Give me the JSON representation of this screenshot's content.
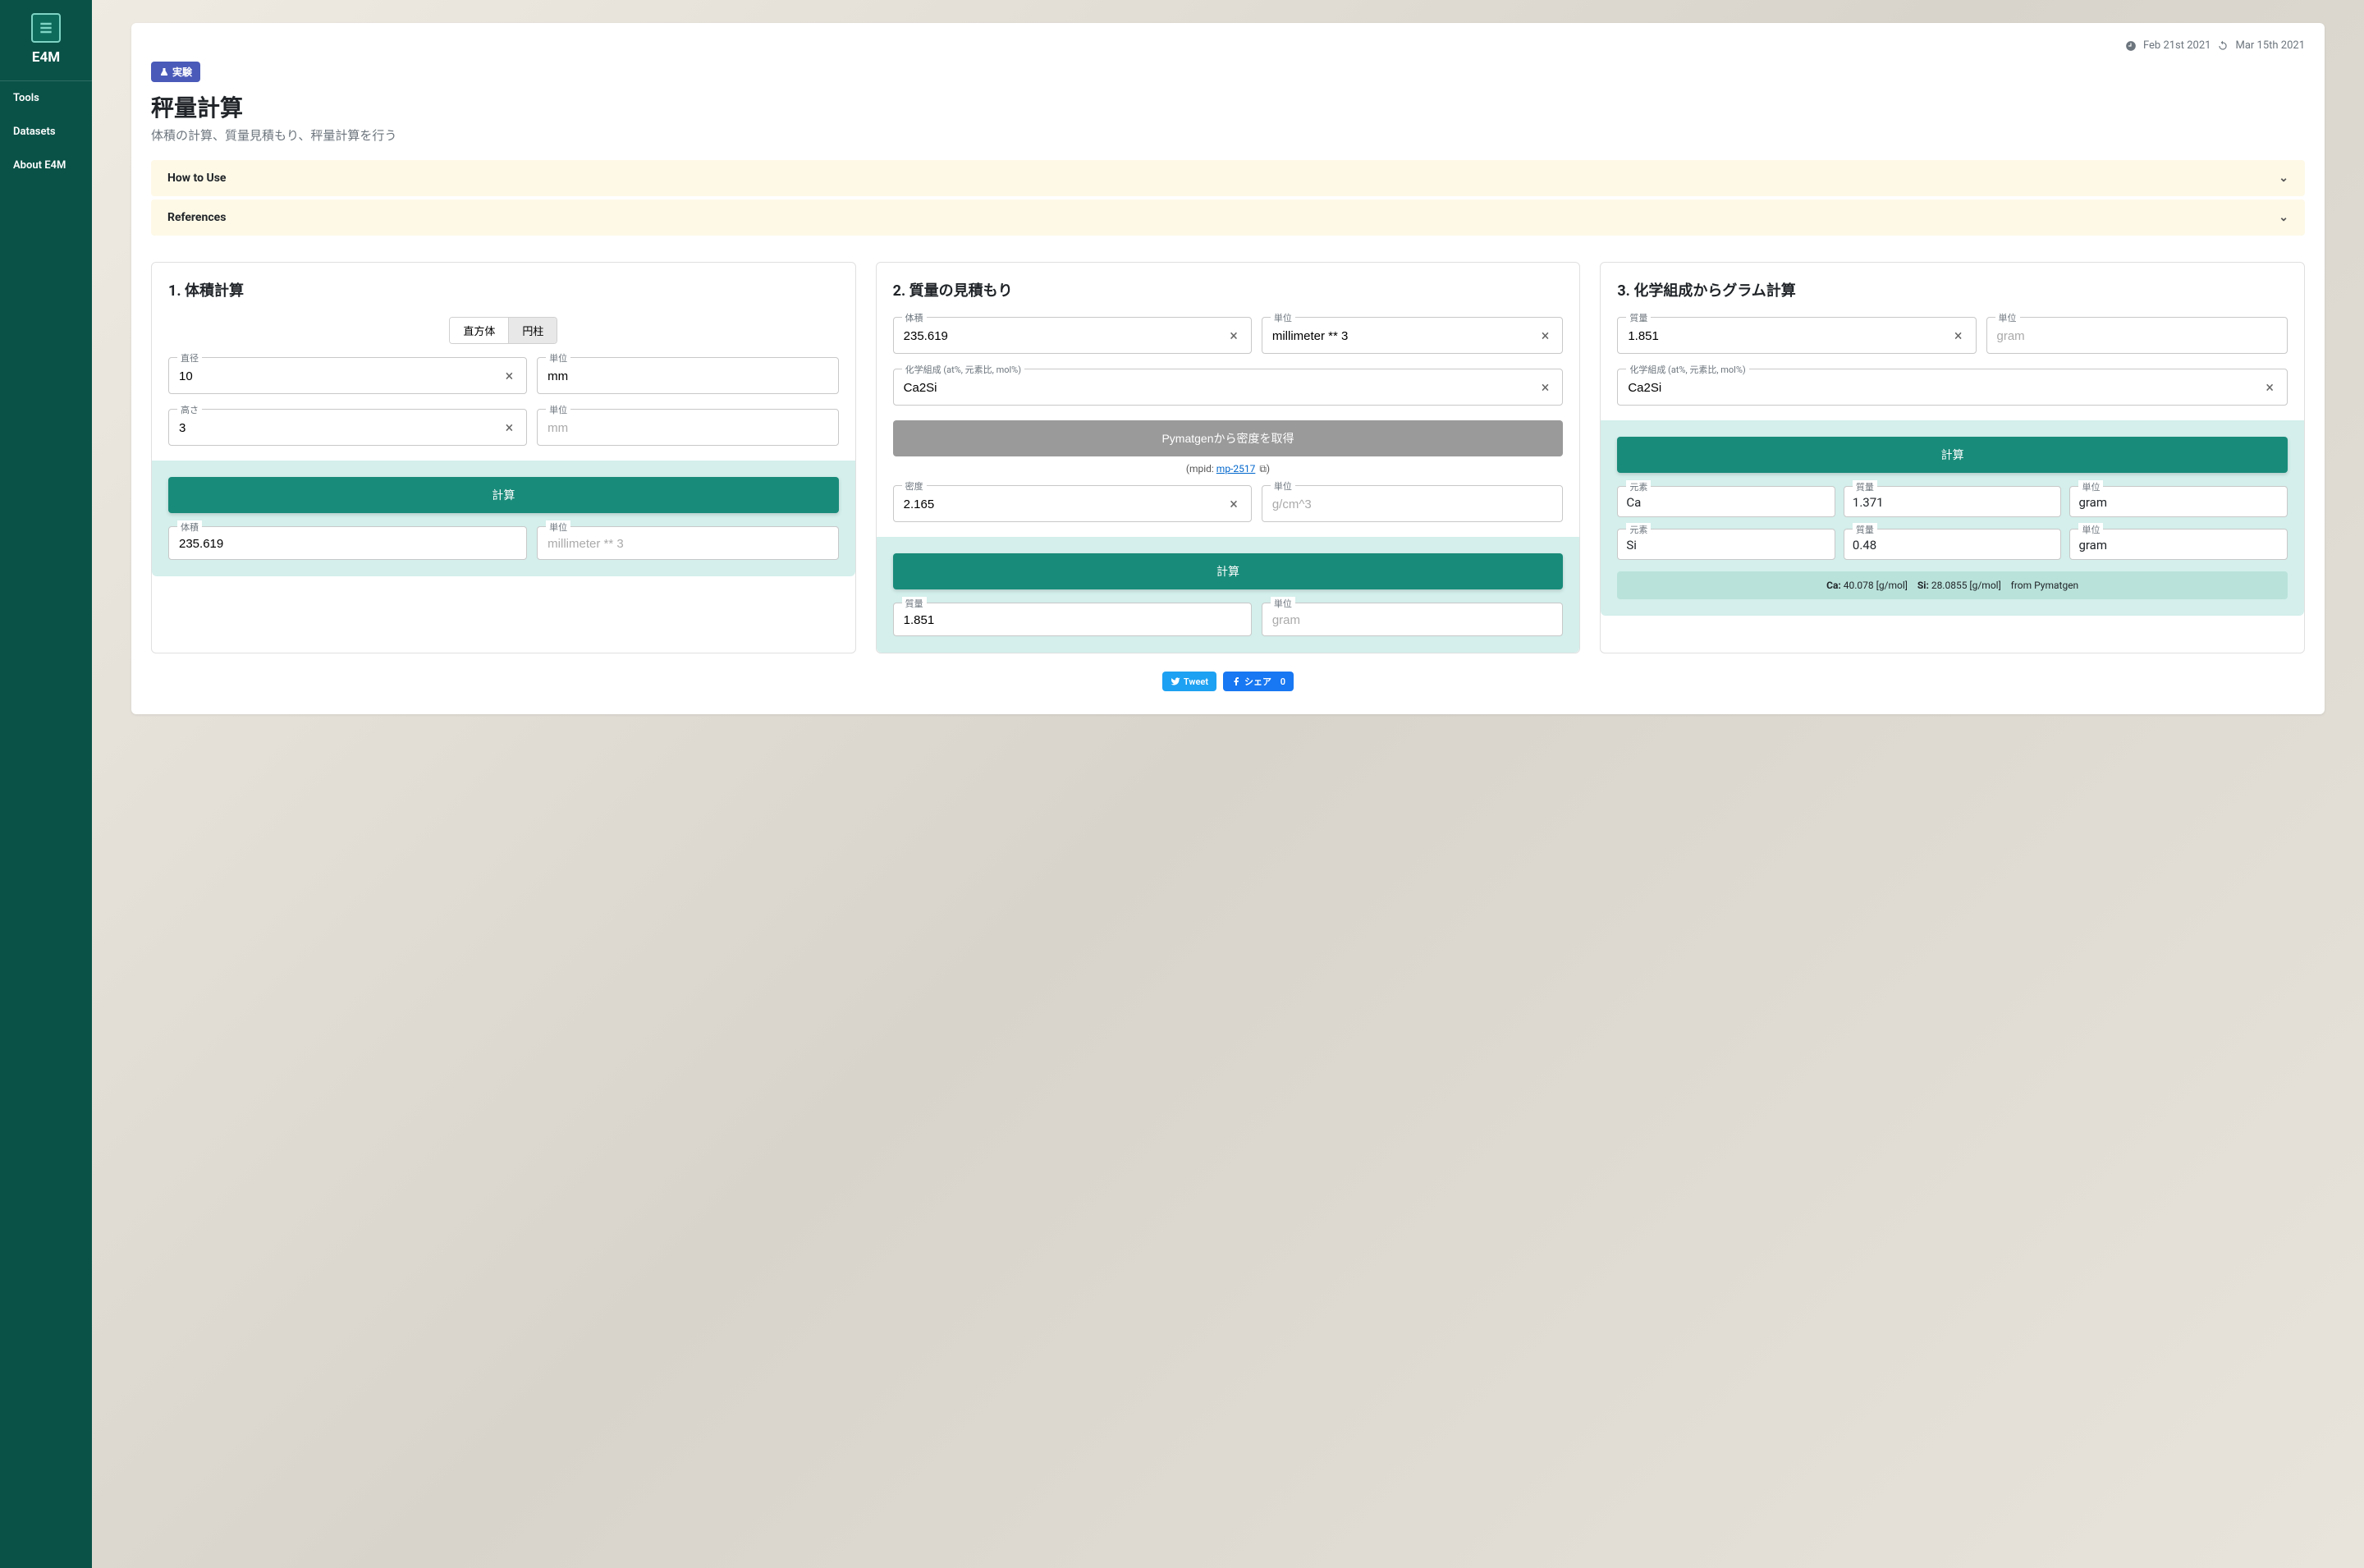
{
  "sidebar": {
    "brand": "E4M",
    "items": [
      {
        "label": "Tools"
      },
      {
        "label": "Datasets"
      },
      {
        "label": "About E4M"
      }
    ]
  },
  "meta": {
    "created": "Feb 21st 2021",
    "updated": "Mar 15th 2021"
  },
  "badge": "実験",
  "title": "秤量計算",
  "subtitle": "体積の計算、質量見積もり、秤量計算を行う",
  "accordions": [
    {
      "label": "How to Use"
    },
    {
      "label": "References"
    }
  ],
  "panel1": {
    "title": "1. 体積計算",
    "seg": {
      "opt1": "直方体",
      "opt2": "円柱"
    },
    "diameter_label": "直径",
    "diameter": "10",
    "unit_label": "単位",
    "diameter_unit": "mm",
    "height_label": "高さ",
    "height": "3",
    "height_unit": "mm",
    "calc_btn": "計算",
    "volume_label": "体積",
    "volume": "235.619",
    "volume_unit": "millimeter ** 3"
  },
  "panel2": {
    "title": "2. 質量の見積もり",
    "volume_label": "体積",
    "volume": "235.619",
    "unit_label": "単位",
    "volume_unit": "millimeter ** 3",
    "comp_label": "化学組成 (at%, 元素比, mol%)",
    "comp": "Ca2Si",
    "pymatgen_btn": "Pymatgenから密度を取得",
    "mpid_prefix": "(mpid: ",
    "mpid_link": "mp-2517",
    "mpid_suffix": ")",
    "density_label": "密度",
    "density": "2.165",
    "density_unit": "g/cm^3",
    "calc_btn": "計算",
    "mass_label": "質量",
    "mass": "1.851",
    "mass_unit": "gram"
  },
  "panel3": {
    "title": "3. 化学組成からグラム計算",
    "mass_label": "質量",
    "mass": "1.851",
    "unit_label": "単位",
    "mass_unit": "gram",
    "comp_label": "化学組成 (at%, 元素比, mol%)",
    "comp": "Ca2Si",
    "calc_btn": "計算",
    "col_element": "元素",
    "col_mass": "質量",
    "col_unit": "単位",
    "rows": [
      {
        "element": "Ca",
        "mass": "1.371",
        "unit": "gram"
      },
      {
        "element": "Si",
        "mass": "0.48",
        "unit": "gram"
      }
    ],
    "info_ca_label": "Ca:",
    "info_ca_val": " 40.078 [g/mol]",
    "info_si_label": "Si:",
    "info_si_val": " 28.0855 [g/mol]",
    "info_src": "from Pymatgen"
  },
  "social": {
    "tweet": "Tweet",
    "share": "シェア",
    "share_count": "0"
  }
}
